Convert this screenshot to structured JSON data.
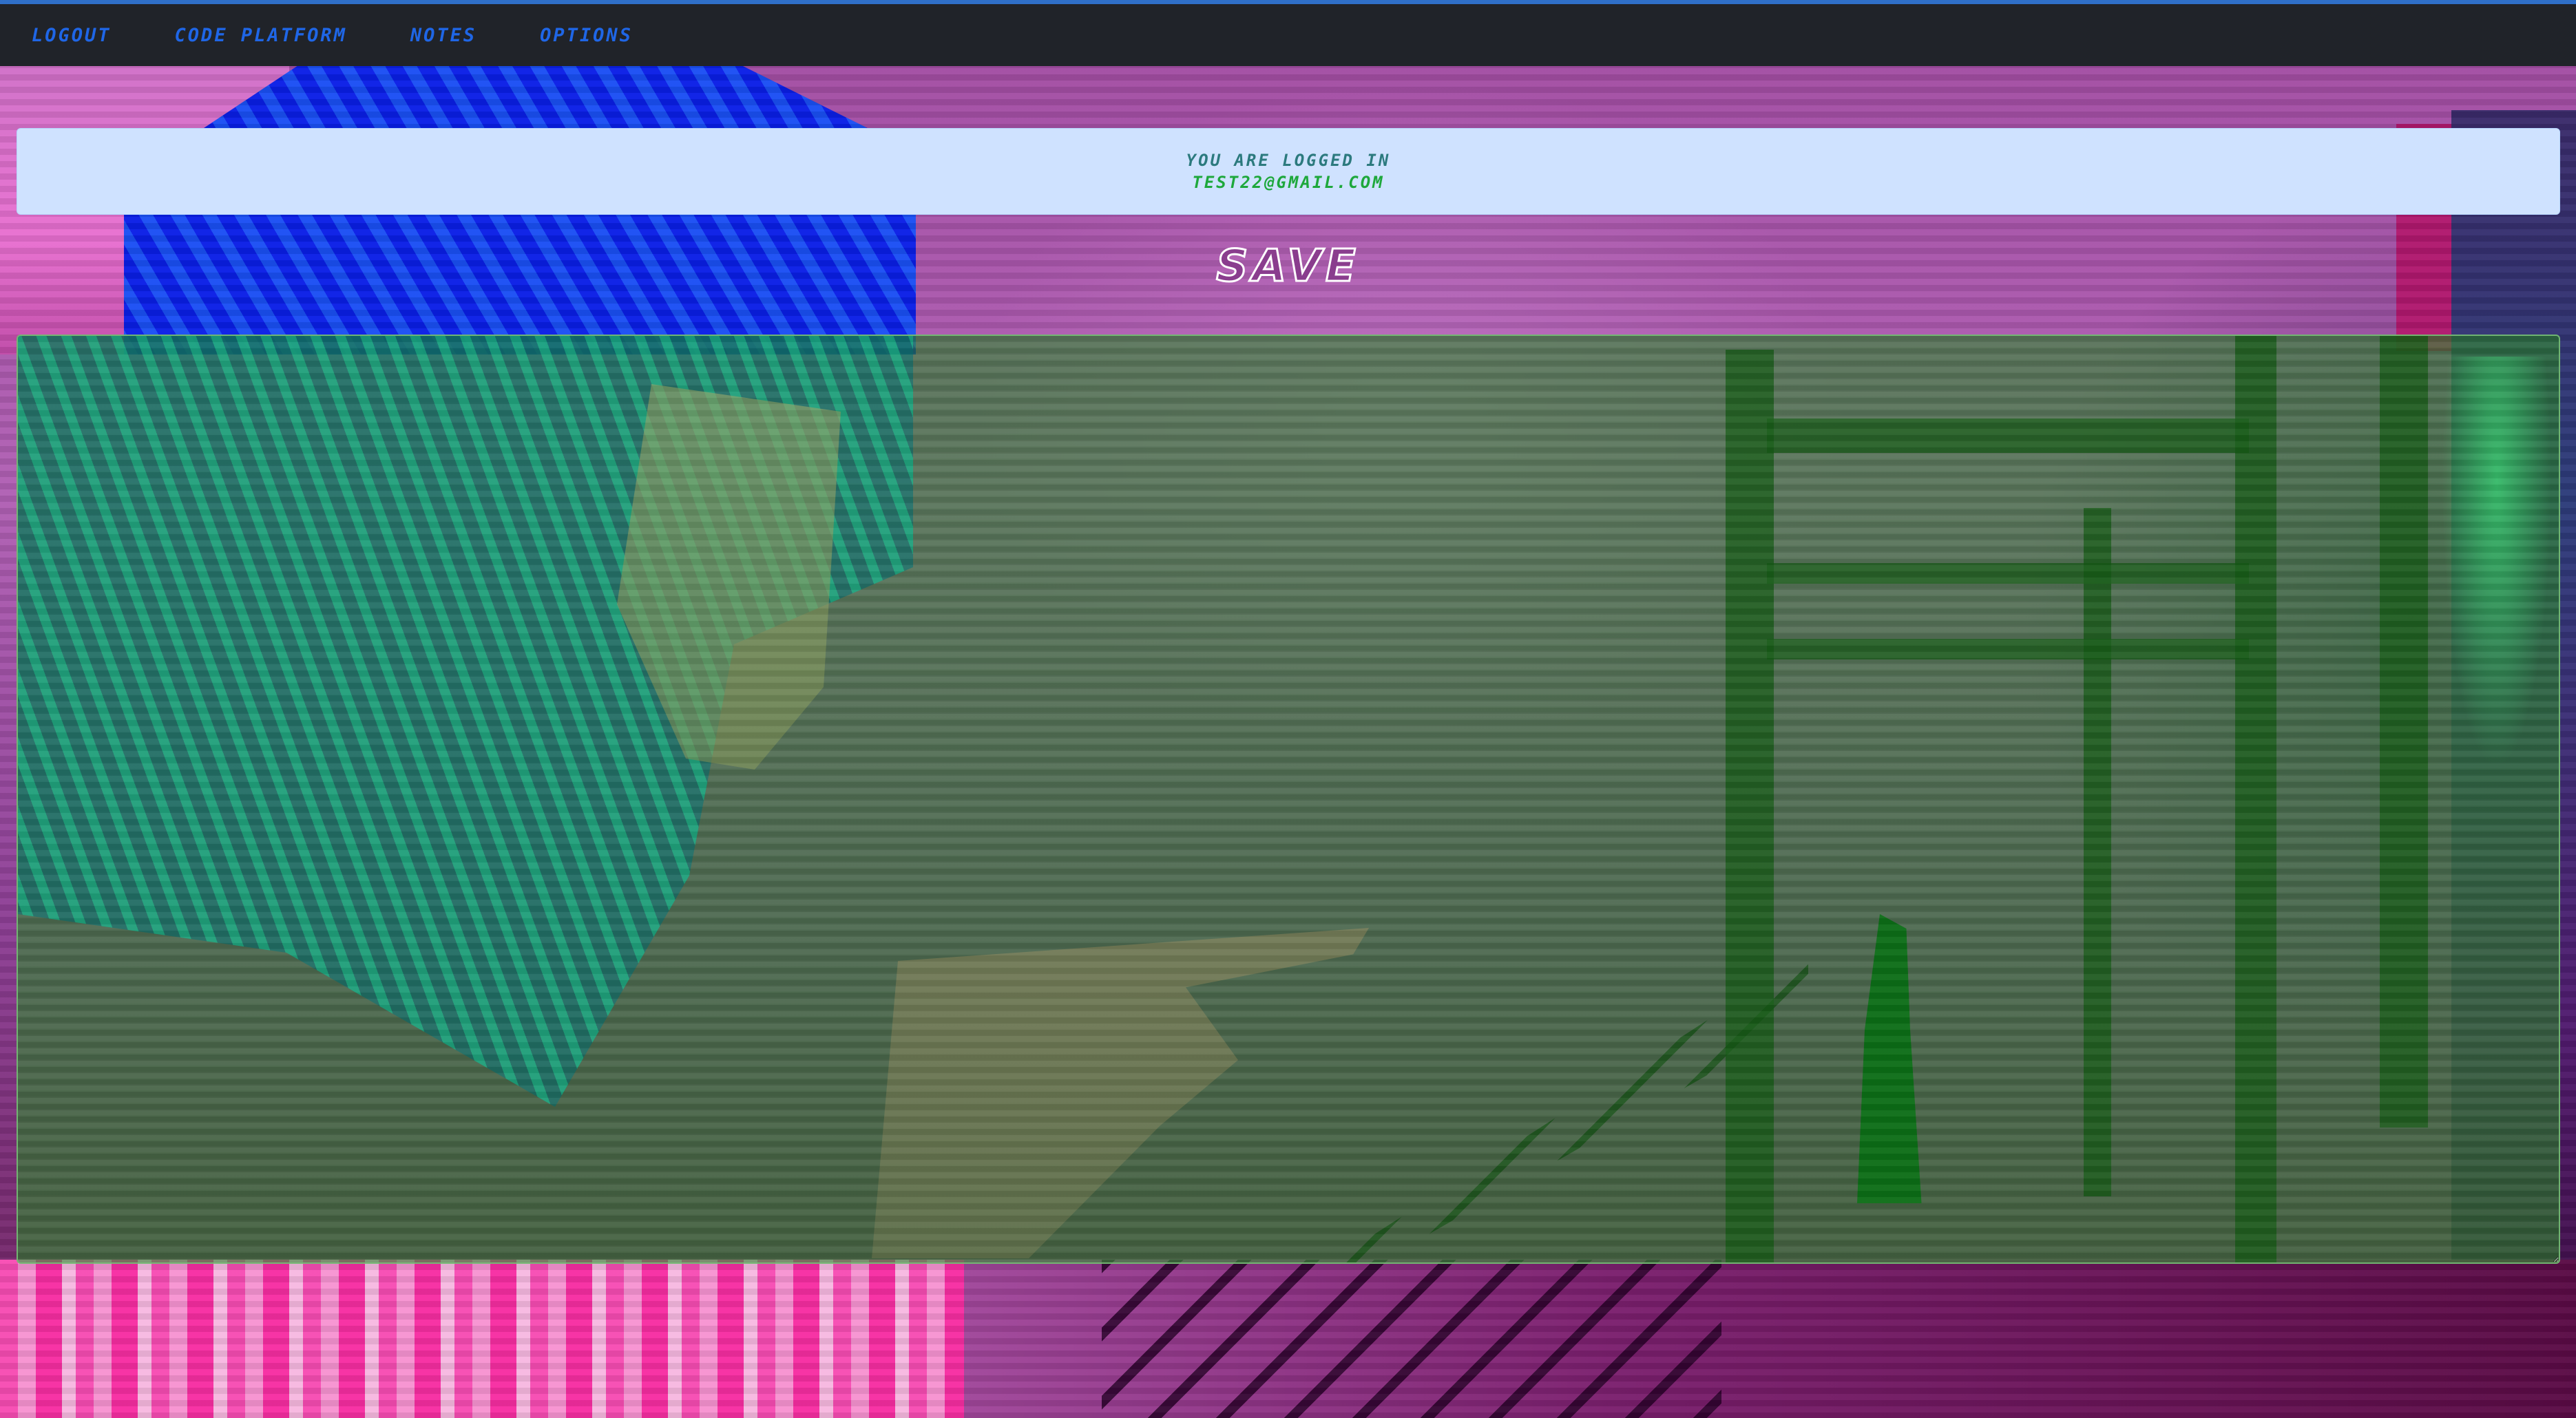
{
  "nav": {
    "items": [
      {
        "label": "LOGOUT"
      },
      {
        "label": "CODE PLATFORM"
      },
      {
        "label": "NOTES"
      },
      {
        "label": "OPTIONS"
      }
    ]
  },
  "alert": {
    "line1": "YOU ARE LOGGED IN",
    "line2": "TEST22@GMAIL.COM"
  },
  "heading": "SAVE",
  "editor": {
    "value": ""
  },
  "colors": {
    "nav_bg": "#202329",
    "nav_link": "#1f66e6",
    "alert_bg": "#cfe2ff",
    "alert_text": "#2c7a7e",
    "alert_email": "#1ea83c",
    "editor_tint": "#288228"
  }
}
